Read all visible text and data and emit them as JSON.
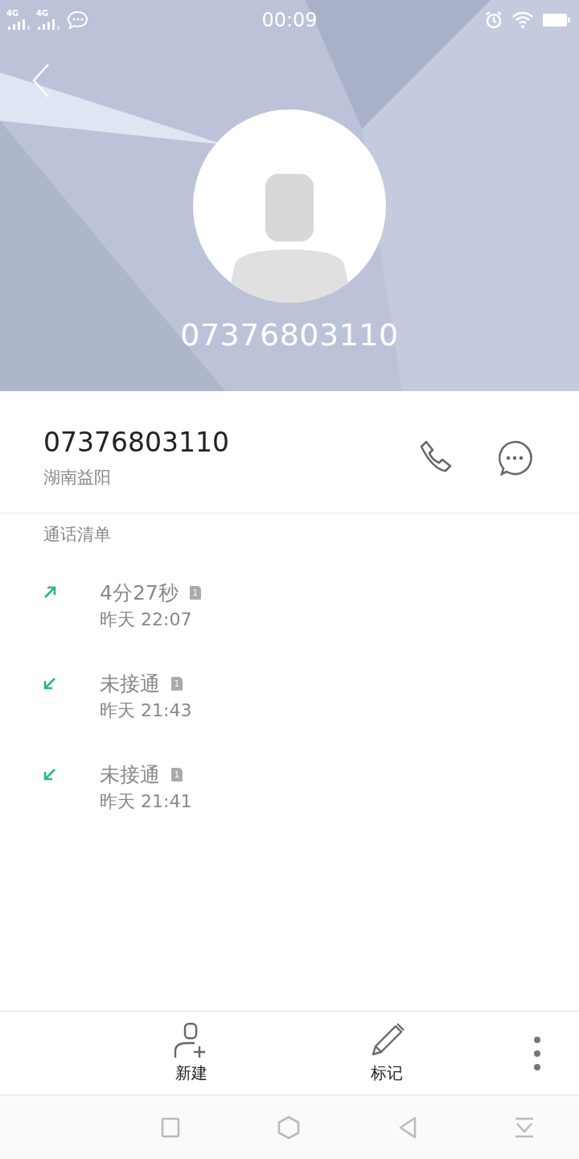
{
  "status_bar": {
    "signals": [
      {
        "label": "4G"
      },
      {
        "label": "4G"
      }
    ],
    "time": "00:09"
  },
  "header": {
    "number": "07376803110"
  },
  "contact": {
    "number": "07376803110",
    "location": "湖南益阳"
  },
  "call_list": {
    "title": "通话清单",
    "entries": [
      {
        "kind": "outgoing",
        "result": "4分27秒",
        "sim": "1",
        "time": "昨天 22:07"
      },
      {
        "kind": "missed",
        "result": "未接通",
        "sim": "1",
        "time": "昨天 21:43"
      },
      {
        "kind": "missed",
        "result": "未接通",
        "sim": "1",
        "time": "昨天 21:41"
      }
    ]
  },
  "toolbar": {
    "buttons": [
      {
        "kind": "new-contact",
        "label": "新建"
      },
      {
        "kind": "mark",
        "label": "标记"
      },
      {
        "kind": "more"
      }
    ]
  }
}
